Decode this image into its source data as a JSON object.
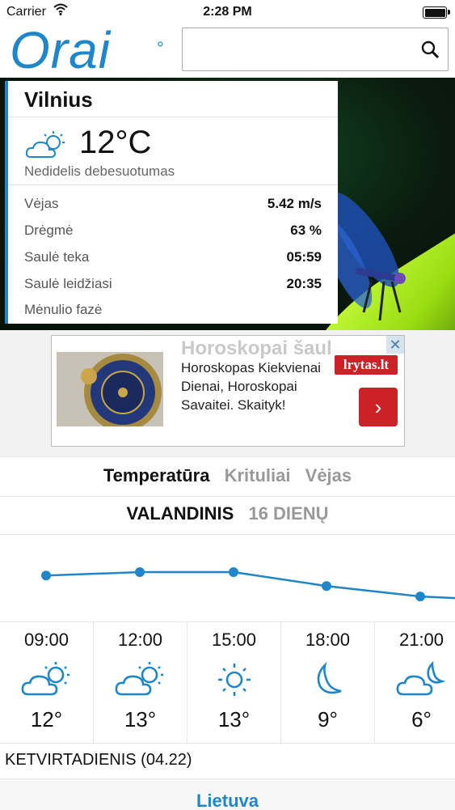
{
  "status_bar": {
    "carrier": "Carrier",
    "time": "2:28 PM"
  },
  "header": {
    "logo": "Orai",
    "logo_degree": "°",
    "search": {
      "value": "",
      "placeholder": ""
    }
  },
  "current": {
    "city": "Vilnius",
    "temperature": "12°C",
    "condition": "Nedidelis debesuotumas",
    "icon": "partly-cloudy-icon",
    "details": [
      {
        "label": "Vėjas",
        "value": "5.42 m/s"
      },
      {
        "label": "Drėgmė",
        "value": "63 %"
      },
      {
        "label": "Saulė teka",
        "value": "05:59"
      },
      {
        "label": "Saulė leidžiasi",
        "value": "20:35"
      },
      {
        "label": "Mėnulio fazė",
        "value": ""
      }
    ]
  },
  "ad": {
    "ghost_title": "Horoskopai šaul",
    "text": "Horoskopas Kiekvienai Dienai, Horoskopai Savaitei. Skaityk!",
    "brand": "lrytas.lt",
    "close": "✕",
    "arrow": "›"
  },
  "tabs_primary": [
    {
      "label": "Temperatūra",
      "active": true
    },
    {
      "label": "Krituliai",
      "active": false
    },
    {
      "label": "Vėjas",
      "active": false
    }
  ],
  "tabs_secondary": [
    {
      "label": "VALANDINIS",
      "active": true
    },
    {
      "label": "16 DIENŲ",
      "active": false
    }
  ],
  "chart_data": {
    "type": "line",
    "categories": [
      "09:00",
      "12:00",
      "15:00",
      "18:00",
      "21:00"
    ],
    "values": [
      12,
      13,
      13,
      9,
      6
    ],
    "xlabel": "",
    "ylabel": ""
  },
  "hourly": [
    {
      "time": "09:00",
      "temp": "12°",
      "icon": "partly-cloudy-icon"
    },
    {
      "time": "12:00",
      "temp": "13°",
      "icon": "partly-cloudy-icon"
    },
    {
      "time": "15:00",
      "temp": "13°",
      "icon": "sun-icon"
    },
    {
      "time": "18:00",
      "temp": "9°",
      "icon": "moon-icon"
    },
    {
      "time": "21:00",
      "temp": "6°",
      "icon": "cloudy-night-icon"
    }
  ],
  "day_label": "KETVIRTADIENIS (04.22)",
  "bottom_nav": {
    "label": "Lietuva"
  },
  "colors": {
    "accent": "#1e86c9",
    "ad_red": "#cc2127"
  }
}
